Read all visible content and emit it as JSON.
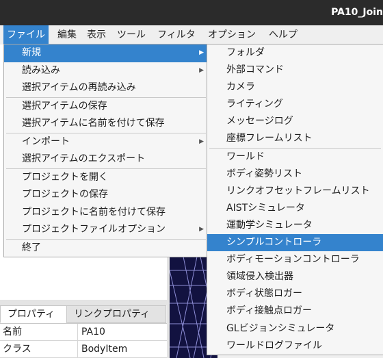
{
  "window": {
    "title": "PA10_Join"
  },
  "menubar": {
    "items": [
      {
        "label": "ファイル"
      },
      {
        "label": "編集"
      },
      {
        "label": "表示"
      },
      {
        "label": "ツール"
      },
      {
        "label": "フィルタ"
      },
      {
        "label": "オプション"
      },
      {
        "label": "ヘルプ"
      }
    ]
  },
  "file_menu": {
    "items": [
      {
        "label": "新規",
        "submenu": true
      },
      {
        "label": "読み込み",
        "submenu": true
      },
      {
        "label": "選択アイテムの再読み込み"
      },
      {
        "label": "選択アイテムの保存"
      },
      {
        "label": "選択アイテムに名前を付けて保存"
      },
      {
        "label": "インポート",
        "submenu": true
      },
      {
        "label": "選択アイテムのエクスポート"
      },
      {
        "label": "プロジェクトを開く"
      },
      {
        "label": "プロジェクトの保存"
      },
      {
        "label": "プロジェクトに名前を付けて保存"
      },
      {
        "label": "プロジェクトファイルオプション",
        "submenu": true
      },
      {
        "label": "終了"
      }
    ],
    "arrow_glyph": "▶"
  },
  "new_submenu": {
    "items": [
      {
        "label": "フォルダ"
      },
      {
        "label": "外部コマンド"
      },
      {
        "label": "カメラ"
      },
      {
        "label": "ライティング"
      },
      {
        "label": "メッセージログ"
      },
      {
        "label": "座標フレームリスト"
      },
      {
        "label": "ワールド"
      },
      {
        "label": "ボディ姿勢リスト"
      },
      {
        "label": "リンクオフセットフレームリスト"
      },
      {
        "label": "AISTシミュレータ"
      },
      {
        "label": "運動学シミュレータ"
      },
      {
        "label": "シンプルコントローラ"
      },
      {
        "label": "ボディモーションコントローラ"
      },
      {
        "label": "領域侵入検出器"
      },
      {
        "label": "ボディ状態ロガー"
      },
      {
        "label": "ボディ接触点ロガー"
      },
      {
        "label": "GLビジョンシミュレータ"
      },
      {
        "label": "ワールドログファイル"
      }
    ]
  },
  "property_tabs": [
    {
      "label": "プロパティ"
    },
    {
      "label": "リンクプロパティ"
    }
  ],
  "properties": {
    "rows": [
      {
        "key": "名前",
        "value": "PA10"
      },
      {
        "key": "クラス",
        "value": "BodyItem"
      }
    ]
  },
  "colors": {
    "highlight": "#3483cd",
    "titlebar": "#2b2b2b",
    "viewport": "#121240"
  }
}
